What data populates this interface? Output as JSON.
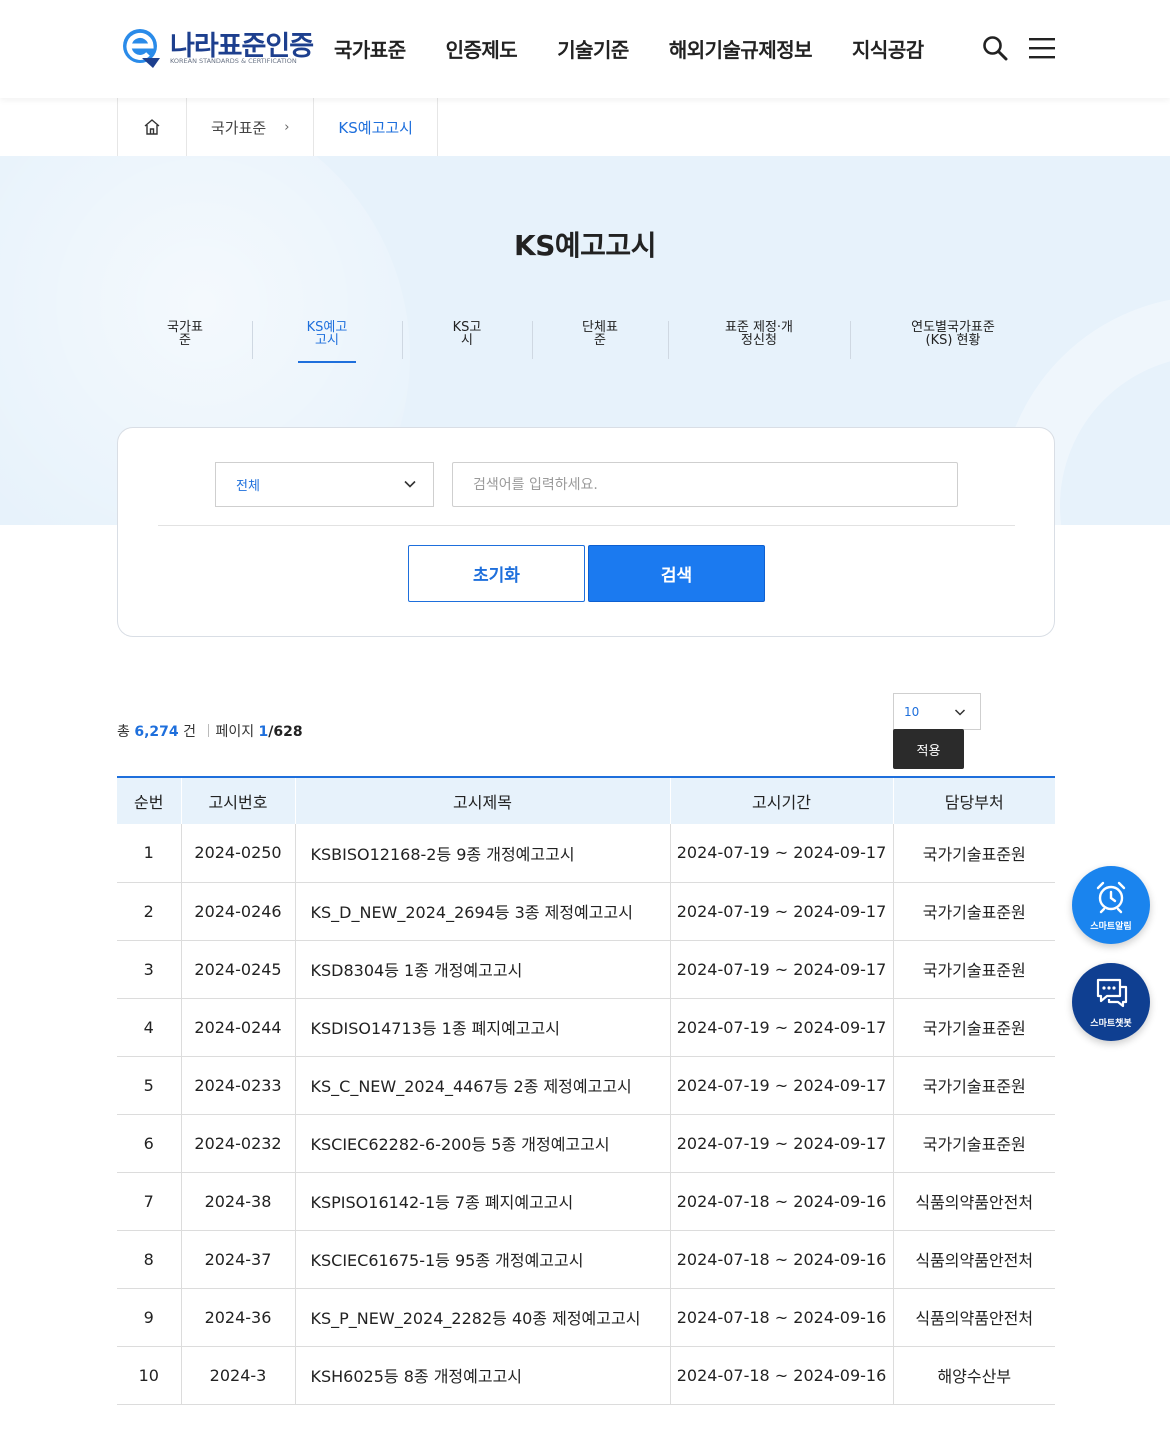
{
  "header": {
    "logo_text": "나라표준인증",
    "logo_sub": "KOREAN STANDARDS & CERTIFICATION",
    "nav": [
      "국가표준",
      "인증제도",
      "기술기준",
      "해외기술규제정보",
      "지식공감"
    ]
  },
  "breadcrumb": {
    "items": [
      "국가표준",
      "KS예고고시"
    ]
  },
  "page_title": "KS예고고시",
  "subnav": [
    {
      "line1": "국가표",
      "line2": "준"
    },
    {
      "line1": "KS예고",
      "line2": "고시"
    },
    {
      "line1": "KS고",
      "line2": "시"
    },
    {
      "line1": "단체표",
      "line2": "준"
    },
    {
      "line1": "표준 제정·개",
      "line2": "정신청"
    },
    {
      "line1": "연도별국가표준",
      "line2": "(KS) 현황"
    }
  ],
  "search": {
    "select_value": "전체",
    "placeholder": "검색어를 입력하세요.",
    "reset_label": "초기화",
    "search_label": "검색"
  },
  "summary": {
    "total_prefix": "총",
    "total": "6,274",
    "total_suffix": "건",
    "page_label": "페이지",
    "page_current": "1",
    "page_total": "/628"
  },
  "per_page": {
    "value": "10",
    "apply_label": "적용"
  },
  "table": {
    "headers": [
      "순번",
      "고시번호",
      "고시제목",
      "고시기간",
      "담당부처"
    ],
    "rows": [
      [
        "1",
        "2024-0250",
        "KSBISO12168-2등 9종 개정예고고시",
        "2024-07-19 ~ 2024-09-17",
        "국가기술표준원"
      ],
      [
        "2",
        "2024-0246",
        "KS_D_NEW_2024_2694등 3종 제정예고고시",
        "2024-07-19 ~ 2024-09-17",
        "국가기술표준원"
      ],
      [
        "3",
        "2024-0245",
        "KSD8304등 1종 개정예고고시",
        "2024-07-19 ~ 2024-09-17",
        "국가기술표준원"
      ],
      [
        "4",
        "2024-0244",
        "KSDISO14713등 1종 폐지예고고시",
        "2024-07-19 ~ 2024-09-17",
        "국가기술표준원"
      ],
      [
        "5",
        "2024-0233",
        "KS_C_NEW_2024_4467등 2종 제정예고고시",
        "2024-07-19 ~ 2024-09-17",
        "국가기술표준원"
      ],
      [
        "6",
        "2024-0232",
        "KSCIEC62282-6-200등 5종 개정예고고시",
        "2024-07-19 ~ 2024-09-17",
        "국가기술표준원"
      ],
      [
        "7",
        "2024-38",
        "KSPISO16142-1등 7종 폐지예고고시",
        "2024-07-18 ~ 2024-09-16",
        "식품의약품안전처"
      ],
      [
        "8",
        "2024-37",
        "KSCIEC61675-1등 95종 개정예고고시",
        "2024-07-18 ~ 2024-09-16",
        "식품의약품안전처"
      ],
      [
        "9",
        "2024-36",
        "KS_P_NEW_2024_2282등 40종 제정예고고시",
        "2024-07-18 ~ 2024-09-16",
        "식품의약품안전처"
      ],
      [
        "10",
        "2024-3",
        "KSH6025등 8종 개정예고고시",
        "2024-07-18 ~ 2024-09-16",
        "해양수산부"
      ]
    ]
  },
  "floating": {
    "alarm_label": "스마트알림",
    "chat_label": "스마트챗봇"
  },
  "colors": {
    "accent": "#1e6fdc",
    "hero_bg": "#e7f2fb",
    "logo_navy": "#1d3f8e"
  }
}
